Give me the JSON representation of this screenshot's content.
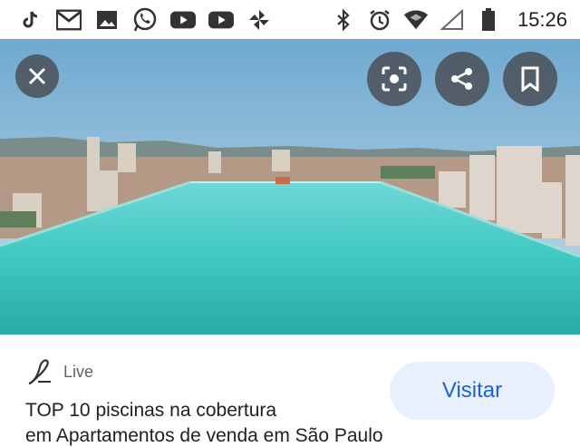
{
  "status_bar": {
    "time": "15:26",
    "left_icons": [
      "tiktok-icon",
      "gmail-icon",
      "gallery-icon",
      "whatsapp-icon",
      "youtube-icon",
      "youtube-icon",
      "pinwheel-icon"
    ],
    "right_icons": [
      "bluetooth-icon",
      "alarm-icon",
      "wifi-icon",
      "signal-icon",
      "battery-icon"
    ]
  },
  "viewer": {
    "actions": [
      "close-icon",
      "lens-icon",
      "share-icon",
      "bookmark-icon"
    ]
  },
  "result": {
    "source_name": "Live",
    "title_line1": "TOP 10 piscinas na cobertura",
    "title_line2": "em Apartamentos de venda em São Paulo",
    "visit_label": "Visitar"
  },
  "colors": {
    "accent": "#1a62d0",
    "visit_bg": "#e8f0fd",
    "sky": "#8fc0e0",
    "pool": "#3fc8c2"
  }
}
